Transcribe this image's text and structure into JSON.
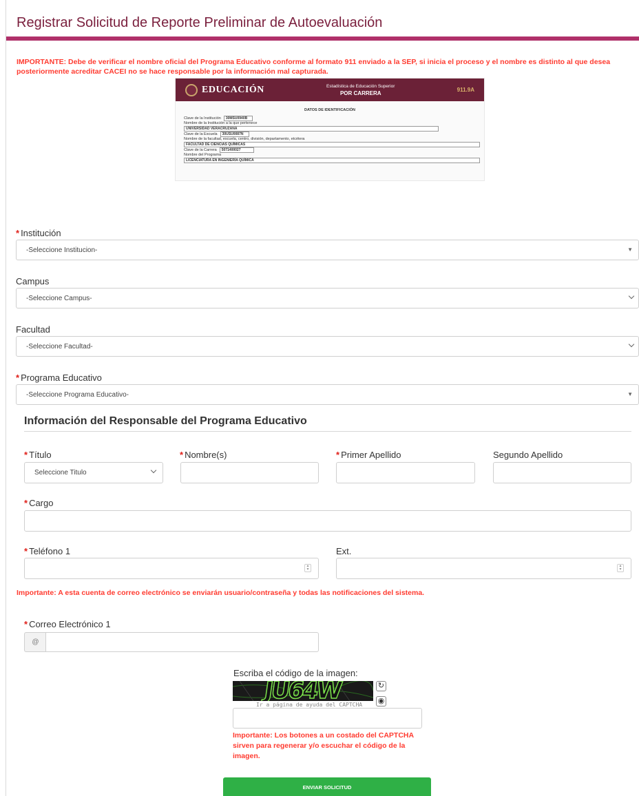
{
  "page": {
    "title": "Registrar Solicitud de Reporte Preliminar de Autoevaluación",
    "important_top": "IMPORTANTE: Debe de verificar el nombre oficial del Programa Educativo conforme al formato 911 enviado a la SEP, si inicia el proceso y el nombre es distinto al que desea posteriormente acreditar CACEI no se hace responsable por la información mal capturada."
  },
  "sep_image": {
    "logo": "EDUCACIÓN",
    "header_sub": "Estadística de Educación Superior",
    "header_main": "POR CARRERA",
    "code": "911.9A",
    "section": "DATOS DE IDENTIFICACIÓN",
    "rows": [
      {
        "label": "Clave de la Institución",
        "value": "30MSU0940B"
      },
      {
        "label": "Nombre de la Institución a la que pertenece",
        "value": ""
      },
      {
        "label": "",
        "value": "UNIVERSIDAD VERACRUZANA"
      },
      {
        "label": "Clave de la Escuela",
        "value": "30USU0087N"
      },
      {
        "label": "Nombre de la facultad, escuela, centro, división, departamento, etcétera",
        "value": ""
      },
      {
        "label": "",
        "value": "FACULTAD DE CIENCIAS QUÍMICAS"
      },
      {
        "label": "Clave de la Carrera",
        "value": "5071400027"
      },
      {
        "label": "Nombre del Programa",
        "value": ""
      },
      {
        "label": "",
        "value": "LICENCIATURA EN INGENIERÍA QUÍMICA"
      }
    ]
  },
  "form": {
    "institucion": {
      "label": "Institución",
      "selected": "-Seleccione Institucion-"
    },
    "campus": {
      "label": "Campus",
      "selected": "-Seleccione Campus-"
    },
    "facultad": {
      "label": "Facultad",
      "selected": "-Seleccione Facultad-"
    },
    "programa": {
      "label": "Programa Educativo",
      "selected": "-Seleccione Programa Educativo-"
    }
  },
  "responsable": {
    "section_title": "Información del Responsable del Programa Educativo",
    "titulo": {
      "label": "Título",
      "selected": "Seleccione Titulo"
    },
    "nombre": {
      "label": "Nombre(s)",
      "value": ""
    },
    "primer_apellido": {
      "label": "Primer Apellido",
      "value": ""
    },
    "segundo_apellido": {
      "label": "Segundo Apellido",
      "value": ""
    },
    "cargo": {
      "label": "Cargo",
      "value": ""
    },
    "telefono": {
      "label": "Teléfono 1",
      "value": ""
    },
    "ext": {
      "label": "Ext.",
      "value": ""
    },
    "important_mid": "Importante: A esta cuenta de correo electrónico se enviarán usuario/contraseña y todas las notificaciones del sistema.",
    "correo": {
      "label": "Correo Electrónico 1",
      "addon": "@",
      "value": ""
    }
  },
  "captcha": {
    "label": "Escriba el código de la imagen:",
    "code_image_text": "JU64W",
    "help_link": "Ir a página de ayuda del CAPTCHA",
    "value": "",
    "important": "Importante: Los botones a un costado del CAPTCHA sirven para regenerar y/o escuchar el código de la imagen.",
    "refresh_icon": "refresh-icon",
    "audio_icon": "audio-icon"
  },
  "submit_label": "ENVIAR SOLICITUD",
  "colors": {
    "title": "#7a1f3d",
    "title_bar": "#b0306a",
    "warning": "#ff3b30",
    "submit": "#2fb046",
    "sep_header": "#6b2137"
  }
}
